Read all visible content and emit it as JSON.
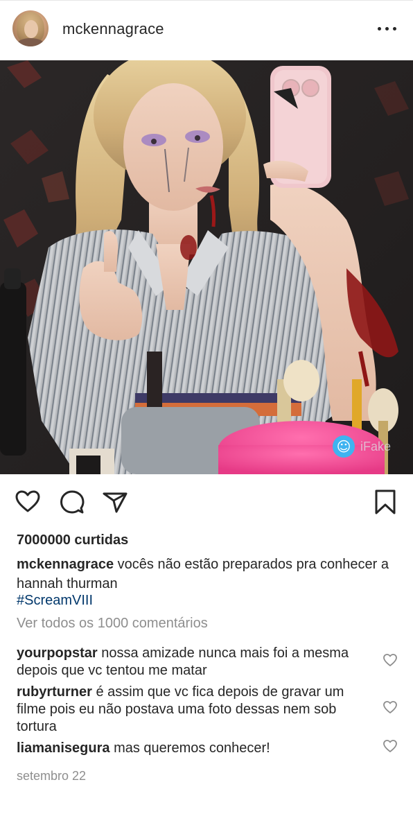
{
  "post": {
    "username": "mckennagrace",
    "likes_label": "7000000 curtidas",
    "caption_user": "mckennagrace",
    "caption_text": "vocês não estão preparados pra conhecer a hannah thurman",
    "hashtag": "#ScreamVIII",
    "view_all_comments": "Ver todos os 1000 comentários",
    "date": "setembro 22",
    "watermark": "iFake"
  },
  "comments": [
    {
      "user": "yourpopstar",
      "text": "nossa amizade nunca mais foi a mesma depois que vc tentou me matar"
    },
    {
      "user": "rubyrturner",
      "text": "é assim que vc fica depois de gravar um filme pois eu não postava uma foto dessas nem sob tortura"
    },
    {
      "user": "liamanisegura",
      "text": "mas queremos conhecer!"
    }
  ],
  "colors": {
    "text": "#262626",
    "secondary": "#8e8e8e",
    "hashtag": "#00376b",
    "watermark_badge": "#3fb3f0"
  },
  "icons": {
    "like": "heart-icon",
    "comment": "comment-bubble-icon",
    "share": "paper-plane-icon",
    "save": "bookmark-icon",
    "more": "more-options-icon",
    "comment_like": "small-heart-icon"
  }
}
